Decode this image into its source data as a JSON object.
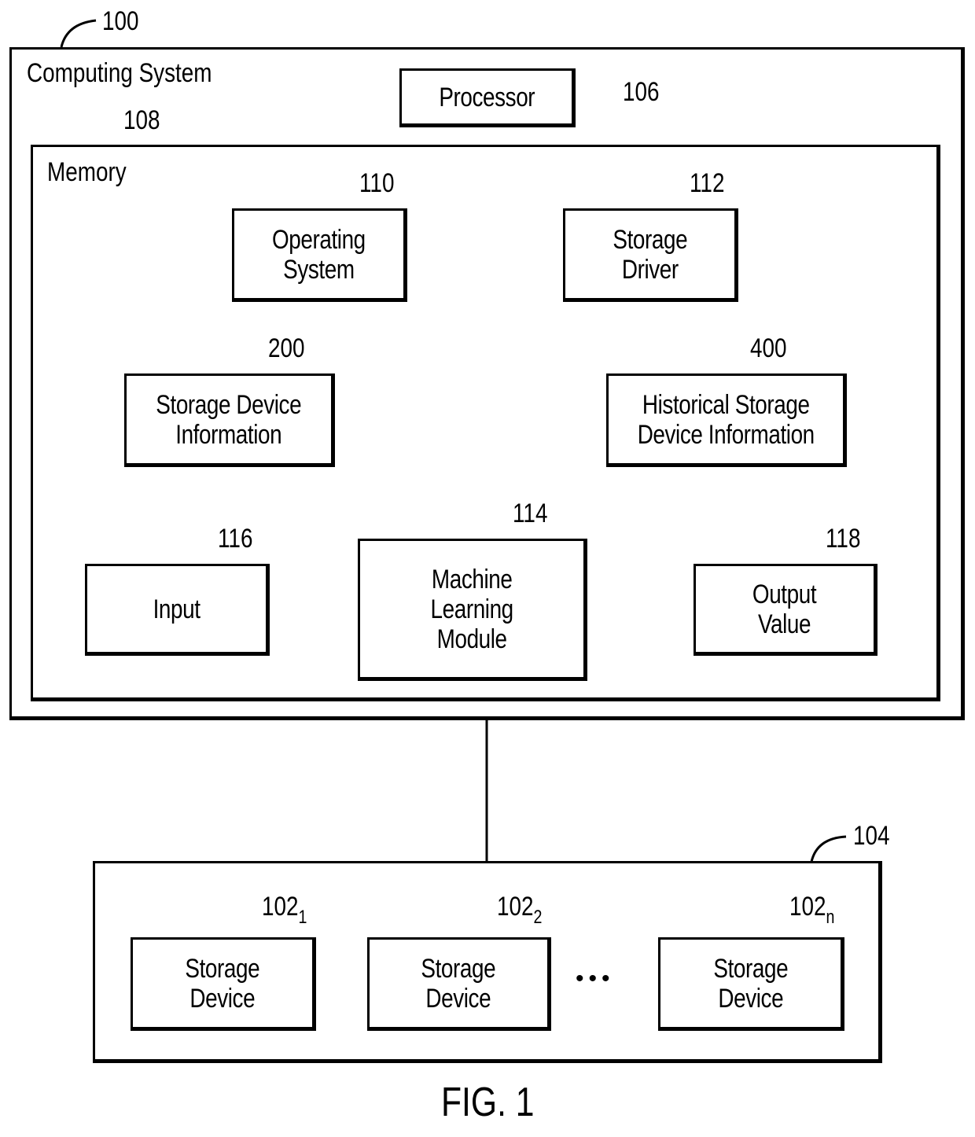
{
  "computing_system": {
    "ref": "100",
    "label": "Computing System"
  },
  "processor": {
    "ref": "106",
    "label": "Processor"
  },
  "memory": {
    "ref": "108",
    "label": "Memory"
  },
  "operating_system": {
    "ref": "110",
    "label": "Operating\nSystem"
  },
  "storage_driver": {
    "ref": "112",
    "label": "Storage\nDriver"
  },
  "storage_device_information": {
    "ref": "200",
    "label": "Storage Device\nInformation"
  },
  "historical_storage_device_information": {
    "ref": "400",
    "label": "Historical Storage\nDevice Information"
  },
  "input": {
    "ref": "116",
    "label": "Input"
  },
  "machine_learning_module": {
    "ref": "114",
    "label": "Machine\nLearning\nModule"
  },
  "output_value": {
    "ref": "118",
    "label": "Output\nValue"
  },
  "storage_array": {
    "ref": "104",
    "devices": [
      {
        "ref": "102",
        "sub": "1",
        "label": "Storage\nDevice"
      },
      {
        "ref": "102",
        "sub": "2",
        "label": "Storage\nDevice"
      },
      {
        "ref": "102",
        "sub": "n",
        "label": "Storage\nDevice"
      }
    ],
    "ellipsis": "•••"
  },
  "figure_label": "FIG. 1"
}
